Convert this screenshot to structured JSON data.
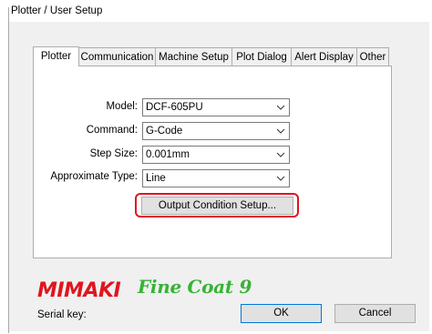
{
  "window": {
    "title": "Plotter / User Setup"
  },
  "tabs": [
    {
      "label": "Plotter",
      "active": true
    },
    {
      "label": "Communication",
      "active": false
    },
    {
      "label": "Machine Setup",
      "active": false
    },
    {
      "label": "Plot Dialog",
      "active": false
    },
    {
      "label": "Alert Display",
      "active": false
    },
    {
      "label": "Other",
      "active": false
    }
  ],
  "form": {
    "model": {
      "label": "Model:",
      "value": "DCF-605PU"
    },
    "command": {
      "label": "Command:",
      "value": "G-Code"
    },
    "step_size": {
      "label": "Step Size:",
      "value": "0.001mm"
    },
    "approx_type": {
      "label": "Approximate Type:",
      "value": "Line"
    },
    "output_condition_button": "Output Condition Setup..."
  },
  "branding": {
    "logo_mimaki": "MIMAKI",
    "logo_finecoat": "Fine Coat 9"
  },
  "footer": {
    "serial_label": "Serial key:",
    "ok_label": "OK",
    "cancel_label": "Cancel"
  },
  "colors": {
    "highlight": "#e0151f",
    "mimaki_red": "#e0151f",
    "finecoat_green": "#36b336"
  }
}
